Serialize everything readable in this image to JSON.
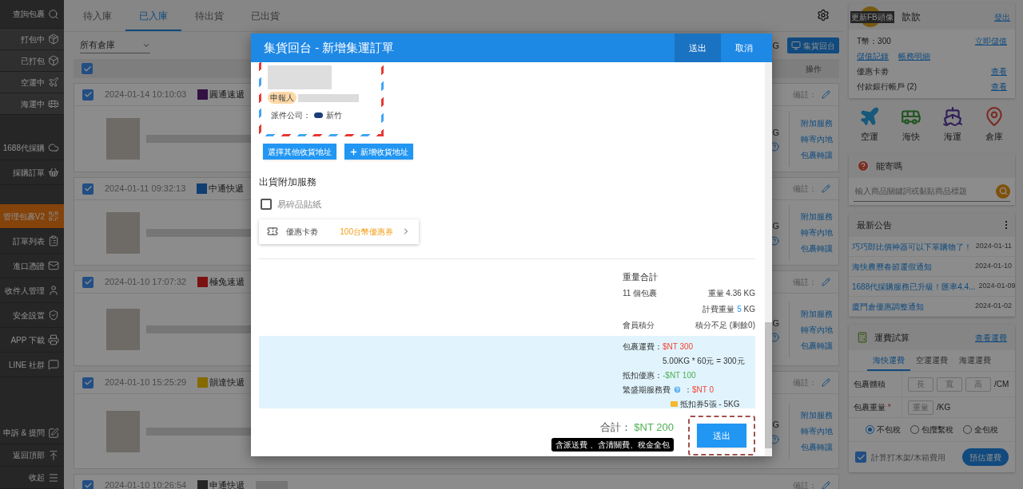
{
  "sidebar": {
    "top": [
      {
        "label": "查詢包裹",
        "selected": false
      }
    ],
    "status": [
      {
        "label": "打包中",
        "selected": false
      },
      {
        "label": "已打包",
        "selected": false
      },
      {
        "label": "空運中",
        "selected": false
      },
      {
        "label": "海運中",
        "selected": false
      }
    ],
    "purchase": [
      {
        "label": "1688代採購",
        "selected": false
      },
      {
        "label": "採購訂單",
        "selected": false
      }
    ],
    "manage": [
      {
        "label": "管理包裹V2",
        "selected": true
      },
      {
        "label": "訂單列表",
        "selected": false
      },
      {
        "label": "進口憑證",
        "selected": false
      },
      {
        "label": "收件人管理",
        "selected": false
      },
      {
        "label": "安全設置",
        "selected": false
      },
      {
        "label": "APP 下載",
        "selected": false
      },
      {
        "label": "LINE 社群",
        "selected": false
      }
    ],
    "bottom": [
      {
        "label": "申訴 & 提問",
        "selected": false
      },
      {
        "label": "返回頂部",
        "selected": false
      },
      {
        "label": "收起",
        "selected": false
      }
    ]
  },
  "main": {
    "tabs": [
      {
        "label": "待入庫",
        "selected": false
      },
      {
        "label": "已入庫",
        "selected": true
      },
      {
        "label": "待出貨",
        "selected": false
      },
      {
        "label": "已出貨",
        "selected": false
      }
    ],
    "warehouse_select": {
      "value": "所有倉庫"
    },
    "toolbar_fragment": "G",
    "collect_button": "集貨回台",
    "header": {
      "select_all_checked": true,
      "actions_column": "操作"
    },
    "packages": [
      {
        "checked": true,
        "date": "2024-01-14 10:10:03",
        "courier": "圓通速遞",
        "note_label": "備註：",
        "weight_fragment": "G",
        "actions": [
          "附加服務",
          "轉寄內地",
          "包裹轉讓"
        ]
      },
      {
        "checked": true,
        "date": "2024-01-11 09:32:13",
        "courier": "中通快遞",
        "note_label": "備註：",
        "weight_fragment": "G",
        "actions": [
          "附加服務",
          "轉寄內地",
          "包裹轉讓"
        ]
      },
      {
        "checked": true,
        "date": "2024-01-10 17:07:32",
        "courier": "極兔速遞",
        "note_label": "備註：",
        "weight_fragment": "G",
        "actions": [
          "附加服務",
          "轉寄內地",
          "包裹轉讓"
        ]
      },
      {
        "checked": true,
        "date": "2024-01-10 15:25:29",
        "courier": "韻達快遞",
        "note_label": "備註：",
        "weight_fragment": "G",
        "actions": [
          "附加服務",
          "轉寄內地",
          "包裹轉讓"
        ]
      },
      {
        "checked": true,
        "date": "2024-01-10 10:26:54",
        "courier": "申通快遞",
        "note_label": "備註："
      }
    ]
  },
  "account": {
    "avatar_overlay": "更新FB頭像",
    "name": "歆歆",
    "logout": "登出",
    "coins": "T幣：300",
    "topup": "立即儲值",
    "links": [
      "儲值記錄",
      "帳務明細"
    ],
    "rows": [
      {
        "label": "優惠卡劵",
        "action": "查看"
      },
      {
        "label": "付款銀行帳戶 (2)",
        "action": "查看"
      }
    ]
  },
  "shortcuts": [
    {
      "label": "空運"
    },
    {
      "label": "海快"
    },
    {
      "label": "海運"
    },
    {
      "label": "倉庫"
    }
  ],
  "item_check": {
    "title": "能寄嗎",
    "placeholder": "輸入商品關鍵詞或黏貼商品標題"
  },
  "news": {
    "title": "最新公告",
    "items": [
      {
        "title": "巧巧郎比價神器可以下單購物了！",
        "date": "2024-01-11"
      },
      {
        "title": "海快農曆春節運假通知",
        "date": "2024-01-10"
      },
      {
        "title": "1688代採購服務已升級！匯率4.4...",
        "date": "2024-01-09"
      },
      {
        "title": "廈門倉優惠調整通知",
        "date": "2024-01-02"
      }
    ]
  },
  "calculator": {
    "title": "運費試算",
    "link": "查看運費",
    "tabs": [
      {
        "label": "海快運費",
        "selected": true
      },
      {
        "label": "空運運費",
        "selected": false
      },
      {
        "label": "海運運費",
        "selected": false
      }
    ],
    "volume": {
      "label": "包裹體積",
      "placeholders": [
        "長",
        "寬",
        "高"
      ],
      "unit": "/CM"
    },
    "weight": {
      "label": "包裹重量",
      "required_mark": "*",
      "placeholder": "重量",
      "unit": "/KG"
    },
    "tax_options": [
      {
        "label": "不包稅",
        "selected": true
      },
      {
        "label": "包攬繫稅",
        "selected": false
      },
      {
        "label": "全包稅",
        "selected": false
      }
    ],
    "crate_option": {
      "label": "計算打木架/木箱費用",
      "checked": true
    },
    "estimate_button": "預估運費"
  },
  "modal": {
    "title": "集貨回台 - 新增集運訂單",
    "header_buttons": [
      {
        "label": "送出",
        "kind": "submit"
      },
      {
        "label": "取消",
        "kind": "cancel"
      }
    ],
    "address": {
      "tag": "申報人",
      "courier_label": "派件公司：",
      "courier": "新竹"
    },
    "address_buttons": [
      {
        "label": "選擇其他收貨地址",
        "kind": "plain"
      },
      {
        "label": "新增收貨地址",
        "kind": "add"
      }
    ],
    "services": {
      "title": "出貨附加服務",
      "options": [
        {
          "label": "易碎品貼紙",
          "checked": false
        }
      ]
    },
    "coupon": {
      "label": "優惠卡劵",
      "value": "100台幣優惠券"
    },
    "summary": {
      "title": "重量合計",
      "count": "11 個包裹",
      "weight": "重量 4.36 KG",
      "billed_label": "計費重量",
      "billed_value": "5",
      "billed_unit": "KG",
      "points_label": "會員積分",
      "points_value": "積分不足 (剩餘0)"
    },
    "fees": {
      "shipping_label": "包裹運費：",
      "shipping": "$NT 300",
      "formula": "5.00KG * 60元 = 300元",
      "discount_label": "抵扣優惠：",
      "discount": "-$NT 100",
      "peak_label": "繁盛期服務費",
      "peak_sep": "：",
      "peak": "$NT 0",
      "voucher": "抵扣券5張 - 5KG"
    },
    "total": {
      "label": "合計：",
      "value": "$NT 200",
      "note": "含派送費 、含清關費、稅金全包"
    },
    "submit": "送出"
  }
}
